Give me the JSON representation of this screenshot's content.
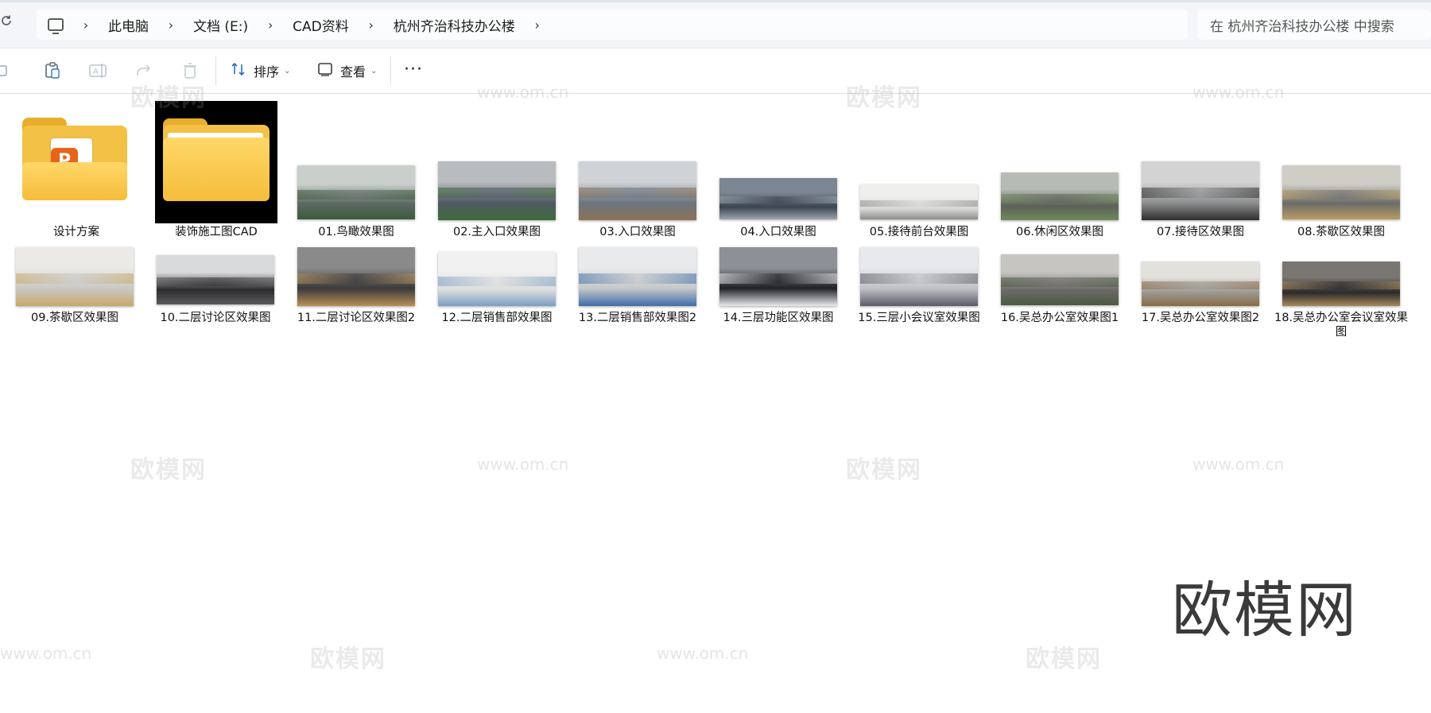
{
  "address": {
    "crumbs": [
      "此电脑",
      "文档 (E:)",
      "CAD资料",
      "杭州齐治科技办公楼"
    ],
    "chevron": "›"
  },
  "search": {
    "placeholder": "在 杭州齐治科技办公楼 中搜索"
  },
  "toolbar": {
    "sort_label": "排序",
    "view_label": "查看",
    "more_label": "···",
    "icons": [
      "copy-icon",
      "paste-icon",
      "rename-icon",
      "share-icon",
      "delete-icon",
      "sort-icon",
      "view-icon",
      "more-icon"
    ]
  },
  "folders": [
    {
      "name": "设计方案",
      "icon": "folder-with-file-icon"
    },
    {
      "name": "装饰施工图CAD",
      "icon": "folder-icon"
    }
  ],
  "images": [
    {
      "name": "01.鸟瞰效果图",
      "colors": [
        "#5d6a64",
        "#c9cfcb",
        "#3d5a3a"
      ]
    },
    {
      "name": "02.主入口效果图",
      "colors": [
        "#4f5964",
        "#b9bcbe",
        "#3f6b39"
      ]
    },
    {
      "name": "03.入口效果图",
      "colors": [
        "#6a7580",
        "#cfd3d6",
        "#8b7255"
      ]
    },
    {
      "name": "04.入口效果图",
      "colors": [
        "#3c4450",
        "#7b8692",
        "#9aa5ad"
      ]
    },
    {
      "name": "05.接待前台效果图",
      "colors": [
        "#d7d8d6",
        "#efefed",
        "#8d8c88"
      ]
    },
    {
      "name": "06.休闲区效果图",
      "colors": [
        "#5b6158",
        "#b7bbb5",
        "#6f8a5c"
      ]
    },
    {
      "name": "07.接待区效果图",
      "colors": [
        "#8f9091",
        "#d3d3d3",
        "#2e2e2e"
      ]
    },
    {
      "name": "08.茶歇区效果图",
      "colors": [
        "#6b6c6a",
        "#cfcdc6",
        "#b99c63"
      ]
    },
    {
      "name": "09.茶歇区效果图",
      "colors": [
        "#c9c8c4",
        "#ebeae6",
        "#c8a86a"
      ]
    },
    {
      "name": "10.二层讨论区效果图",
      "colors": [
        "#2c2c2e",
        "#d9dadb",
        "#5a5a5c"
      ]
    },
    {
      "name": "11.二层讨论区效果图2",
      "colors": [
        "#3a3a3a",
        "#8a8a8a",
        "#b8905a"
      ]
    },
    {
      "name": "12.二层销售部效果图",
      "colors": [
        "#dcdddd",
        "#f1f1f1",
        "#7a9ec3"
      ]
    },
    {
      "name": "13.二层销售部效果图2",
      "colors": [
        "#c5c7c9",
        "#e9eaeb",
        "#3f6ea8"
      ]
    },
    {
      "name": "14.三层功能区效果图",
      "colors": [
        "#1f2124",
        "#8d9197",
        "#e9eaec"
      ]
    },
    {
      "name": "15.三层小会议室效果图",
      "colors": [
        "#bfc1c6",
        "#e8e9ec",
        "#5b5c68"
      ]
    },
    {
      "name": "16.吴总办公室效果图1",
      "colors": [
        "#6c6a66",
        "#c7c5c0",
        "#4b5a43"
      ]
    },
    {
      "name": "17.吴总办公室效果图2",
      "colors": [
        "#9a9791",
        "#e3e1dc",
        "#8a6a45"
      ]
    },
    {
      "name": "18.吴总办公室会议室效果图",
      "colors": [
        "#2b2b2c",
        "#7a7772",
        "#a7885a"
      ]
    }
  ],
  "brand": "欧模网",
  "watermark": {
    "text": "欧模网",
    "url": "www.om.cn"
  }
}
